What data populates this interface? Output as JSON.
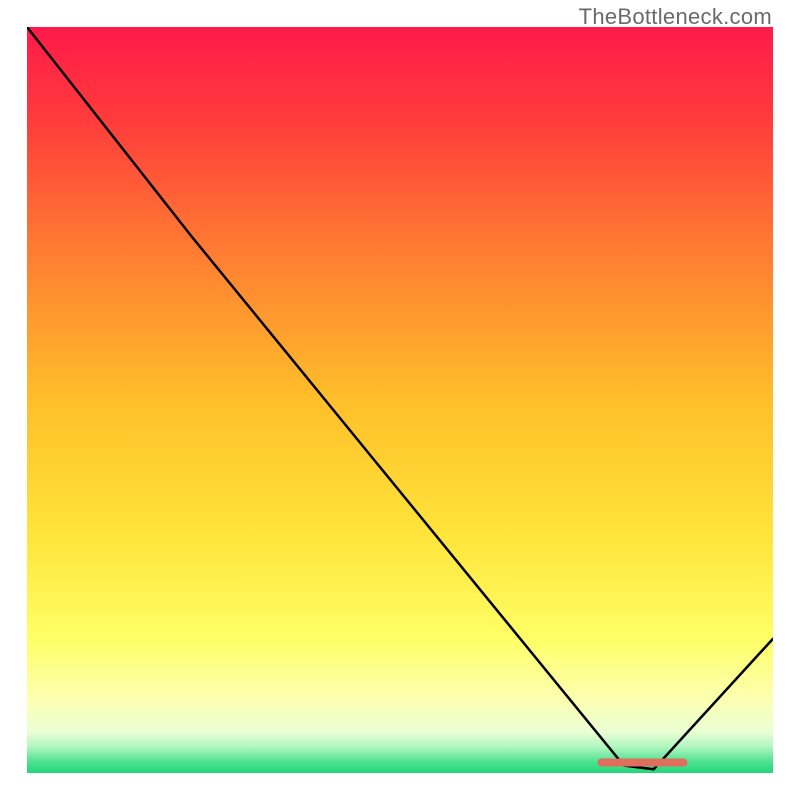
{
  "watermark": "TheBottleneck.com",
  "chart_data": {
    "type": "line",
    "title": "",
    "xlabel": "",
    "ylabel": "",
    "xlim": [
      0,
      100
    ],
    "ylim": [
      0,
      100
    ],
    "gradient_stops": [
      {
        "offset": 0.0,
        "color": "#ff1a4b"
      },
      {
        "offset": 0.12,
        "color": "#ff3a3c"
      },
      {
        "offset": 0.3,
        "color": "#ff7c32"
      },
      {
        "offset": 0.5,
        "color": "#ffbf2a"
      },
      {
        "offset": 0.68,
        "color": "#ffe43a"
      },
      {
        "offset": 0.82,
        "color": "#ffff66"
      },
      {
        "offset": 0.9,
        "color": "#fcffb0"
      },
      {
        "offset": 0.945,
        "color": "#eaffd4"
      },
      {
        "offset": 0.965,
        "color": "#b0f6c0"
      },
      {
        "offset": 0.985,
        "color": "#4ee28f"
      },
      {
        "offset": 1.0,
        "color": "#22d67a"
      }
    ],
    "series": [
      {
        "name": "bottleneck-curve",
        "points": [
          {
            "x": 0.0,
            "y": 100.0
          },
          {
            "x": 22.0,
            "y": 72.0
          },
          {
            "x": 80.0,
            "y": 1.0
          },
          {
            "x": 84.0,
            "y": 0.5
          },
          {
            "x": 100.0,
            "y": 18.0
          }
        ]
      }
    ],
    "highlight_segment": {
      "name": "optimal-zone",
      "y": 1.4,
      "x_start": 77.0,
      "x_end": 88.0,
      "color": "#e06e5d"
    }
  }
}
